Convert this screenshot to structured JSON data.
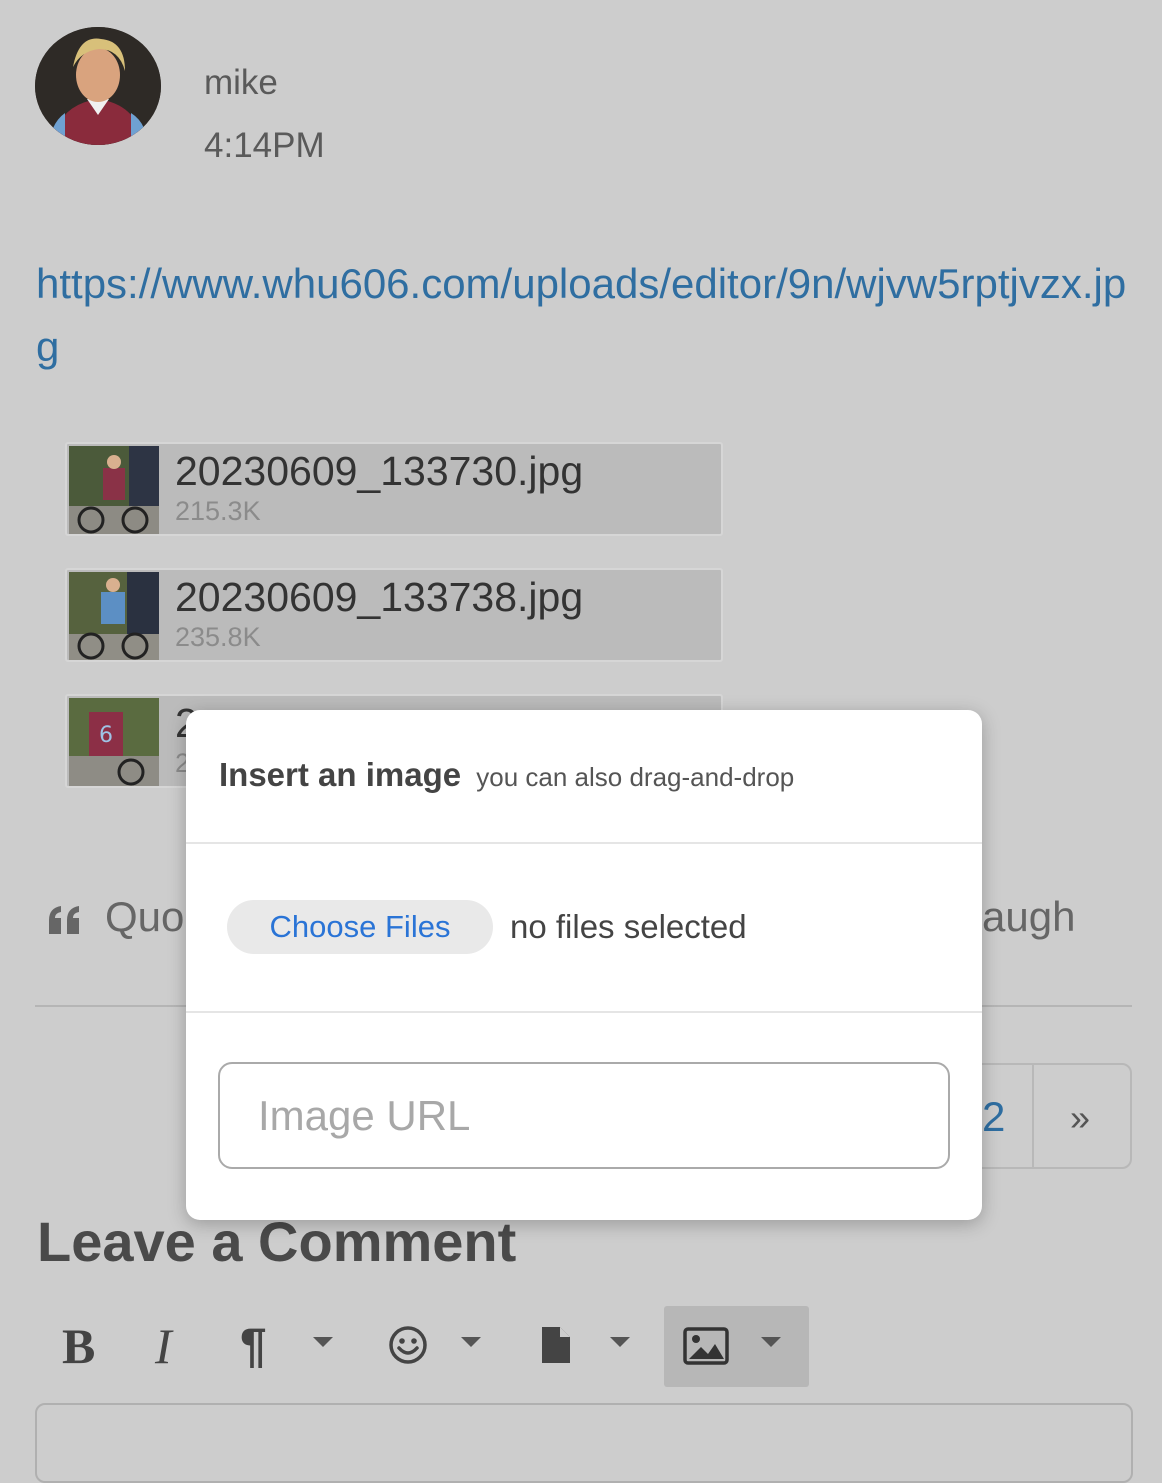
{
  "post": {
    "author": "mike",
    "time": "4:14PM",
    "link": "https://www.whu606.com/uploads/editor/9n/wjvw5rptjvzx.jpg"
  },
  "attachments": [
    {
      "filename": "20230609_133730.jpg",
      "size": "215.3K"
    },
    {
      "filename": "20230609_133738.jpg",
      "size": "235.8K"
    },
    {
      "filename": "2",
      "size": "2"
    }
  ],
  "actions": {
    "quote_label": "Quo",
    "laugh_label": "augh"
  },
  "pagination": {
    "page_label": "2",
    "next_label": "»"
  },
  "comment": {
    "heading": "Leave a Comment"
  },
  "toolbar": {
    "bold_label": "B",
    "italic_label": "I",
    "paragraph_label": "¶"
  },
  "modal": {
    "title": "Insert an image",
    "hint": "you can also drag-and-drop",
    "choose_files_label": "Choose Files",
    "no_files_text": "no files selected",
    "url_placeholder": "Image URL"
  },
  "colors": {
    "link": "#2f6ea1",
    "button_text": "#2a74d6",
    "page_background": "#cdcdcd"
  }
}
